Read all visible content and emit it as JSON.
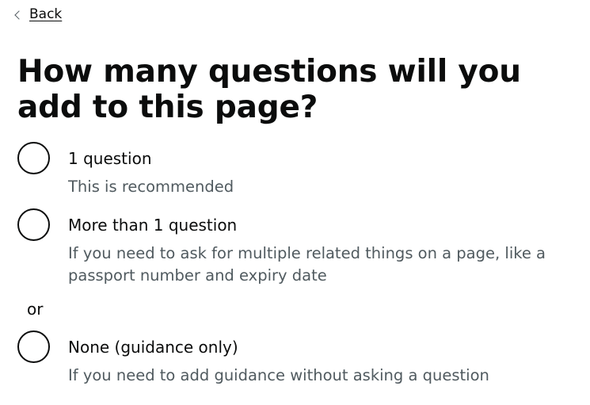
{
  "back": {
    "label": "Back"
  },
  "page": {
    "heading": "How many questions will you add to this page?"
  },
  "options": [
    {
      "label": "1 question",
      "hint": "This is recommended",
      "selected": false
    },
    {
      "label": "More than 1 question",
      "hint": "If you need to ask for multiple related things on a page, like a passport number and expiry date",
      "selected": false
    },
    {
      "label": "None (guidance only)",
      "hint": "If you need to add guidance without asking a question",
      "selected": false
    }
  ],
  "divider": {
    "label": "or"
  },
  "colors": {
    "text": "#0b0c0c",
    "hint": "#505a5f",
    "background": "#ffffff"
  }
}
